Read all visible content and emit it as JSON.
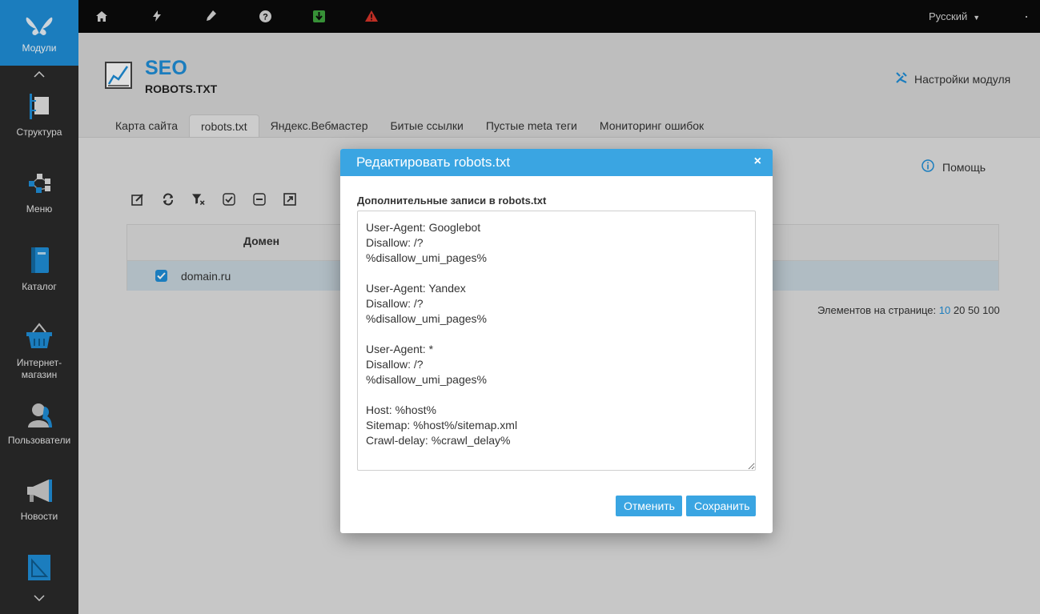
{
  "sidebar": {
    "active": {
      "label": "Модули",
      "icon": "butterfly-icon"
    },
    "items": [
      {
        "label": "Структура",
        "icon": "structure-icon"
      },
      {
        "label": "Меню",
        "icon": "menu-tree-icon"
      },
      {
        "label": "Каталог",
        "icon": "book-icon"
      },
      {
        "label": "Интернет-\nмагазин",
        "icon": "basket-icon"
      },
      {
        "label": "Пользователи",
        "icon": "user-icon"
      },
      {
        "label": "Новости",
        "icon": "megaphone-icon"
      }
    ],
    "scroll_up": "^",
    "scroll_down": "⌄"
  },
  "topbar": {
    "icons": [
      "home-icon",
      "lightning-icon",
      "pen-icon",
      "question-icon",
      "download-icon",
      "warning-icon"
    ],
    "language": "Русский",
    "accent_green": "#3fa53f",
    "accent_red": "#d9352a"
  },
  "module": {
    "title": "SEO",
    "subtitle": "ROBOTS.TXT",
    "settings_label": "Настройки модуля",
    "tabs": [
      "Карта сайта",
      "robots.txt",
      "Яндекс.Вебмастер",
      "Битые ссылки",
      "Пустые meta теги",
      "Мониторинг ошибок"
    ],
    "active_tab": "robots.txt"
  },
  "content": {
    "help_label": "Помощь",
    "toolbar_icons": [
      "edit-icon",
      "refresh-icon",
      "clear-filter-icon",
      "check-all-icon",
      "uncheck-icon",
      "open-icon"
    ],
    "grid": {
      "column_header": "Домен",
      "rows": [
        {
          "domain": "domain.ru",
          "checked": true
        }
      ]
    },
    "pager": {
      "label": "Элементов на странице:",
      "options": [
        "10",
        "20",
        "50",
        "100"
      ],
      "selected": "10"
    }
  },
  "modal": {
    "title": "Редактировать robots.txt",
    "close": "×",
    "field_label": "Дополнительные записи в robots.txt",
    "textarea_value": "User-Agent: Googlebot\nDisallow: /?\n%disallow_umi_pages%\n\nUser-Agent: Yandex\nDisallow: /?\n%disallow_umi_pages%\n\nUser-Agent: *\nDisallow: /?\n%disallow_umi_pages%\n\nHost: %host%\nSitemap: %host%/sitemap.xml\nCrawl-delay: %crawl_delay%",
    "cancel_label": "Отменить",
    "save_label": "Сохранить"
  },
  "colors": {
    "accent": "#1f8fd9",
    "modal_header": "#3aa5e2",
    "sidebar_bg": "#2b2b2b",
    "topbar_bg": "#0b0b0b"
  }
}
